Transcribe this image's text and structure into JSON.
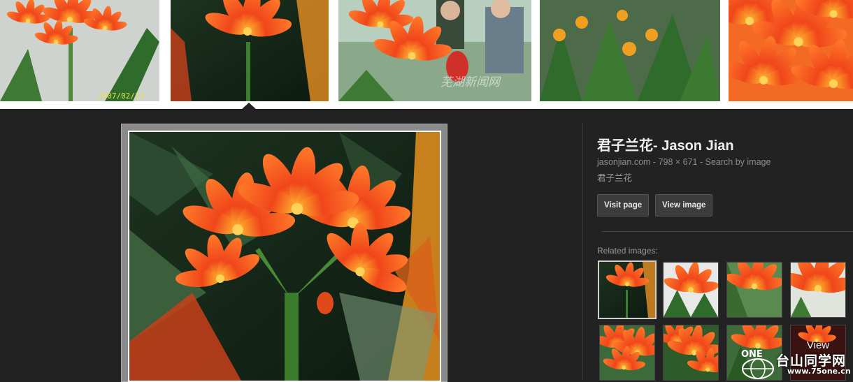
{
  "strip": {
    "thumbnails": [
      {
        "name": "clivia-orange-cluster",
        "datestamp": "2007/02/14"
      },
      {
        "name": "clivia-selected"
      },
      {
        "name": "clivia-people-photo",
        "watermark": "芜湖新闻网"
      },
      {
        "name": "clivia-greenhouse"
      },
      {
        "name": "clivia-closeup"
      }
    ]
  },
  "preview": {
    "alt": "君子兰花"
  },
  "info": {
    "title": "君子兰花- Jason Jian",
    "site": "jasonjian.com",
    "separator1": " - ",
    "dimensions": "798 × 671",
    "separator2": " - ",
    "search_by_image": "Search by image",
    "description": "君子兰花"
  },
  "buttons": {
    "visit_page": "Visit page",
    "view_image": "View image"
  },
  "related": {
    "label": "Related images:",
    "view_label": "View"
  },
  "watermark": {
    "logo": "ONE",
    "text": "台山同学网",
    "url": "www.75one.cn"
  },
  "colors": {
    "background": "#222222",
    "flower_orange": "#f05a1e",
    "flower_yellow": "#ffb020",
    "leaf_green": "#2f6b2a"
  }
}
